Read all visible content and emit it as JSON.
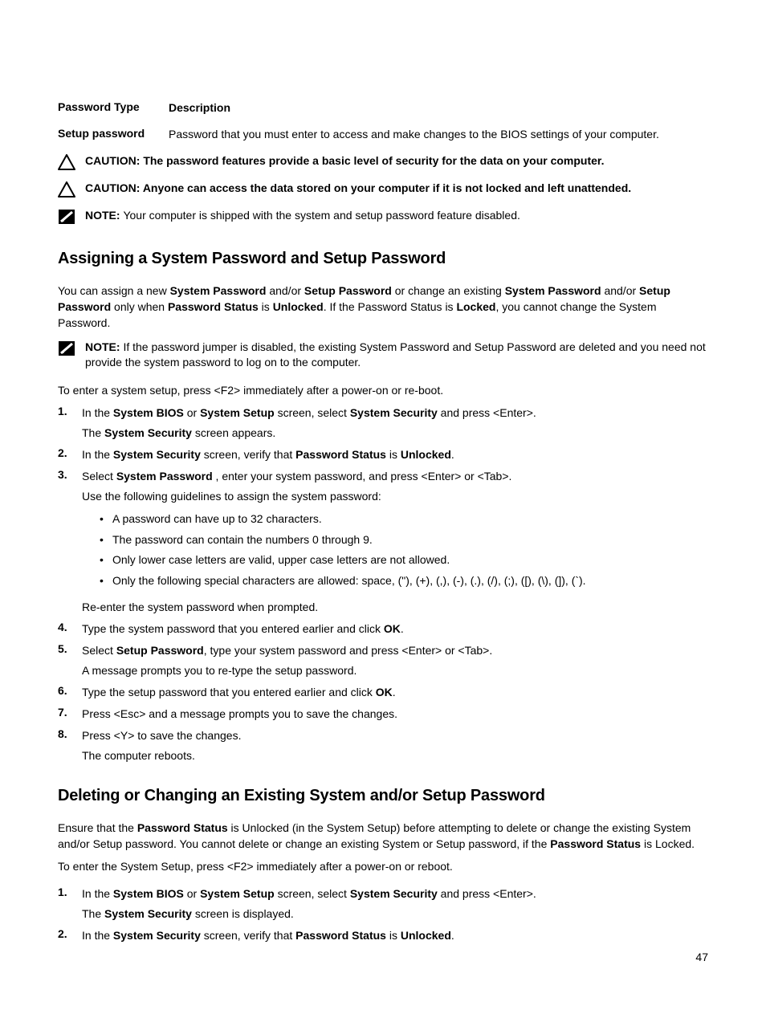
{
  "table": {
    "header_type": "Password Type",
    "header_desc": "Description",
    "row1_type": "Setup password",
    "row1_desc": "Password that you must enter to access and make changes to the BIOS settings of your computer."
  },
  "adm": {
    "caution_label": "CAUTION: ",
    "note_label": "NOTE: ",
    "caution1": "The password features provide a basic level of security for the data on your computer.",
    "caution2": "Anyone can access the data stored on your computer if it is not locked and left unattended.",
    "note1": "Your computer is shipped with the system and setup password feature disabled.",
    "note2": "If the password jumper is disabled, the existing System Password and Setup Password are deleted and you need not provide the system password to log on to the computer."
  },
  "h1": "Assigning a System Password and Setup Password",
  "intro": {
    "t1": "You can assign a new ",
    "b1": "System Password",
    "t2": " and/or ",
    "b2": "Setup Password",
    "t3": " or change an existing ",
    "b3": "System Password",
    "t4": " and/or ",
    "b4": "Setup Password",
    "t5": " only when ",
    "b5": "Password Status",
    "t6": " is ",
    "b6": "Unlocked",
    "t7": ". If the Password Status is ",
    "b7": "Locked",
    "t8": ", you cannot change the System Password."
  },
  "enter_setup": "To enter a system setup, press <F2> immediately after a power-on or re-boot.",
  "steps": {
    "s1a": "In the ",
    "s1b": "System BIOS",
    "s1c": " or ",
    "s1d": "System Setup",
    "s1e": " screen, select ",
    "s1f": "System Security",
    "s1g": " and press <Enter>.",
    "s1sub_a": "The ",
    "s1sub_b": "System Security",
    "s1sub_c": " screen appears.",
    "s2a": "In the ",
    "s2b": "System Security",
    "s2c": " screen, verify that ",
    "s2d": "Password Status",
    "s2e": " is ",
    "s2f": "Unlocked",
    "s2g": ".",
    "s3a": "Select ",
    "s3b": "System Password",
    "s3c": " , enter your system password, and press <Enter> or <Tab>.",
    "s3sub": "Use the following guidelines to assign the system password:",
    "b1": "A password can have up to 32 characters.",
    "b2": "The password can contain the numbers 0 through 9.",
    "b3": "Only lower case letters are valid, upper case letters are not allowed.",
    "b4": "Only the following special characters are allowed: space, (\"), (+), (,), (-), (.), (/), (;), ([), (\\), (]), (`).",
    "s3after": "Re-enter the system password when prompted.",
    "s4a": "Type the system password that you entered earlier and click ",
    "s4b": "OK",
    "s4c": ".",
    "s5a": "Select ",
    "s5b": "Setup Password",
    "s5c": ", type your system password and press <Enter> or <Tab>.",
    "s5sub": "A message prompts you to re-type the setup password.",
    "s6a": "Type the setup password that you entered earlier and click ",
    "s6b": "OK",
    "s6c": ".",
    "s7": "Press <Esc> and a message prompts you to save the changes.",
    "s8": "Press <Y> to save the changes.",
    "s8sub": "The computer reboots."
  },
  "h2": "Deleting or Changing an Existing System and/or Setup Password",
  "del": {
    "t1": "Ensure that the ",
    "b1": "Password Status",
    "t2": " is Unlocked (in the System Setup) before attempting to delete or change the existing System and/or Setup password. You cannot delete or change an existing System or Setup password, if the ",
    "b2": "Password Status",
    "t3": " is Locked.",
    "enter": "To enter the System Setup, press <F2> immediately after a power-on or reboot.",
    "s1a": "In the ",
    "s1b": "System BIOS",
    "s1c": " or ",
    "s1d": "System Setup",
    "s1e": " screen, select ",
    "s1f": "System Security",
    "s1g": " and press <Enter>.",
    "s1sub_a": "The ",
    "s1sub_b": "System Security",
    "s1sub_c": " screen is displayed.",
    "s2a": "In the ",
    "s2b": "System Security",
    "s2c": " screen, verify that ",
    "s2d": "Password Status",
    "s2e": " is ",
    "s2f": "Unlocked",
    "s2g": "."
  },
  "nums": {
    "n1": "1.",
    "n2": "2.",
    "n3": "3.",
    "n4": "4.",
    "n5": "5.",
    "n6": "6.",
    "n7": "7.",
    "n8": "8."
  },
  "page_number": "47"
}
